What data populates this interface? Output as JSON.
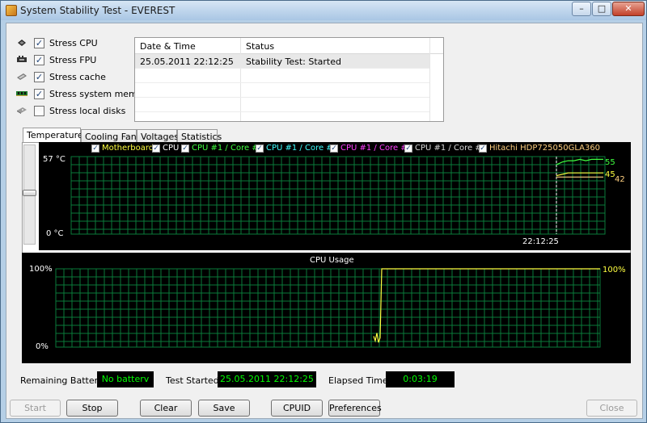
{
  "window": {
    "title": "System Stability Test - EVEREST",
    "min_glyph": "–",
    "max_glyph": "□",
    "close_glyph": "✕"
  },
  "options": [
    {
      "label": "Stress CPU",
      "checked": true,
      "icon": "cpu-chip-icon"
    },
    {
      "label": "Stress FPU",
      "checked": true,
      "icon": "fpu-chip-icon"
    },
    {
      "label": "Stress cache",
      "checked": true,
      "icon": "cache-chip-icon"
    },
    {
      "label": "Stress system memory",
      "checked": true,
      "icon": "memory-module-icon"
    },
    {
      "label": "Stress local disks",
      "checked": false,
      "icon": "hard-disk-icon"
    }
  ],
  "log": {
    "headers": [
      "Date & Time",
      "Status"
    ],
    "rows": [
      {
        "datetime": "25.05.2011 22:12:25",
        "status": "Stability Test: Started"
      }
    ]
  },
  "tabs": [
    "Temperatures",
    "Cooling Fans",
    "Voltages",
    "Statistics"
  ],
  "active_tab": 0,
  "check_glyph": "✓",
  "colors": {
    "grid": "#0a7a3a",
    "motherboard": "#ffff40",
    "cpu": "#ffffff",
    "core1": "#40ff40",
    "core2": "#40ffff",
    "core3": "#ff40ff",
    "core4": "#d8d8d8",
    "hdd": "#ffd080",
    "cpu_usage": "#ffff40",
    "info_text": "#00ff00"
  },
  "chart_data": [
    {
      "type": "line",
      "title": "",
      "legend": [
        {
          "name": "Motherboard",
          "color": "#ffff40"
        },
        {
          "name": "CPU",
          "color": "#ffffff"
        },
        {
          "name": "CPU #1 / Core #1",
          "color": "#40ff40"
        },
        {
          "name": "CPU #1 / Core #2",
          "color": "#40ffff"
        },
        {
          "name": "CPU #1 / Core #3",
          "color": "#ff40ff"
        },
        {
          "name": "CPU #1 / Core #4",
          "color": "#d8d8d8"
        },
        {
          "name": "Hitachi HDP725050GLA360",
          "color": "#ffd080"
        }
      ],
      "y_max_label": "57 °C",
      "y_min_label": "0 °C",
      "ylim": [
        0,
        57
      ],
      "marker_time": "22:12:25",
      "end_values": [
        "55",
        "45",
        "42"
      ],
      "series": [
        {
          "name": "Motherboard",
          "color": "#ffff40",
          "values": [
            43,
            44,
            45,
            45,
            45,
            45,
            45,
            45,
            45
          ]
        },
        {
          "name": "CPU #1 / Core #1",
          "color": "#40ff40",
          "values": [
            51,
            53,
            54,
            54,
            55,
            54,
            55,
            55,
            55
          ]
        },
        {
          "name": "Hitachi HDP725050GLA360",
          "color": "#ffd080",
          "values": [
            42,
            42,
            42,
            42,
            42,
            42,
            42,
            42,
            42
          ]
        }
      ]
    },
    {
      "type": "line",
      "title": "CPU Usage",
      "y_max_label": "100%",
      "y_min_label": "0%",
      "ylim": [
        0,
        100
      ],
      "end_value": "100%",
      "series": [
        {
          "name": "CPU Usage",
          "color": "#ffff40",
          "values": [
            14,
            8,
            18,
            6,
            12,
            100,
            100,
            100,
            100,
            100,
            100,
            100,
            100,
            100,
            100,
            100,
            100,
            100,
            100,
            100,
            100,
            100,
            100,
            100,
            100,
            100,
            100,
            100,
            100,
            100,
            100,
            100,
            100,
            100,
            100,
            100,
            100,
            100,
            100,
            100,
            100,
            100,
            100,
            100,
            100,
            100,
            100,
            100,
            100,
            100,
            100,
            100,
            100,
            100,
            100,
            100,
            100,
            100,
            100,
            100,
            100,
            100,
            100,
            100,
            100,
            100,
            100,
            100,
            100,
            100,
            100,
            100,
            100,
            100,
            100,
            100,
            100,
            100,
            100,
            100,
            100,
            100,
            100,
            100,
            100,
            100,
            100,
            100,
            100,
            100,
            100,
            100,
            100,
            100,
            100,
            100,
            100,
            100,
            100,
            100,
            100,
            100,
            100,
            100,
            100,
            100,
            100,
            100,
            100,
            100,
            100,
            100,
            100,
            100,
            100,
            100,
            100,
            100,
            100,
            100,
            100,
            100,
            100,
            100,
            100,
            100,
            100,
            100,
            100,
            100,
            100,
            100,
            100,
            100,
            100,
            100,
            100,
            100,
            100,
            100,
            100
          ]
        }
      ]
    }
  ],
  "info": {
    "battery_label": "Remaining Battery:",
    "battery_value": "No batterv",
    "started_label": "Test Started:",
    "started_value": "25.05.2011 22:12:25",
    "elapsed_label": "Elapsed Time:",
    "elapsed_value": "0:03:19"
  },
  "buttons": {
    "start": "Start",
    "stop": "Stop",
    "clear": "Clear",
    "save": "Save",
    "cpuid": "CPUID",
    "preferences": "Preferences",
    "close": "Close"
  }
}
